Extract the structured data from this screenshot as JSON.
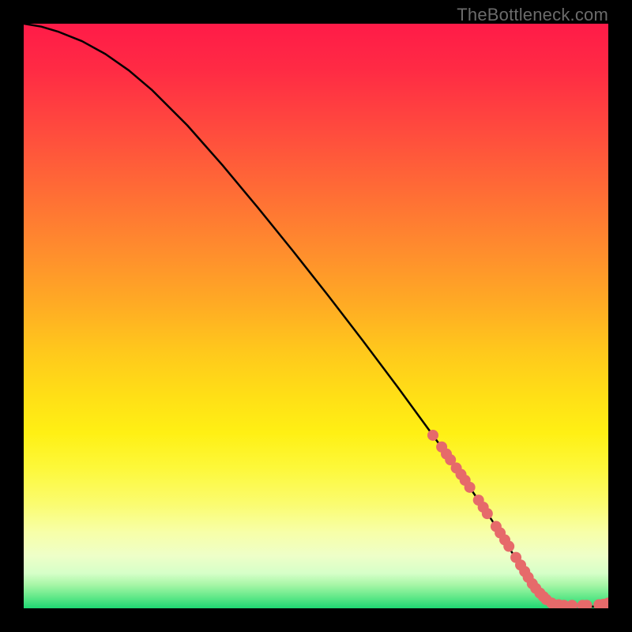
{
  "watermark": "TheBottleneck.com",
  "colors": {
    "line": "#000000",
    "dot_fill": "#e66a6a",
    "dot_stroke": "#c94f4f"
  },
  "chart_data": {
    "type": "line",
    "title": "",
    "xlabel": "",
    "ylabel": "",
    "xlim": [
      0,
      100
    ],
    "ylim": [
      0,
      100
    ],
    "series": [
      {
        "name": "curve",
        "x": [
          0,
          3,
          6,
          10,
          14,
          18,
          22,
          28,
          34,
          40,
          46,
          52,
          58,
          64,
          70,
          75,
          80,
          84,
          87,
          89,
          91,
          93,
          95,
          97,
          100
        ],
        "y": [
          100,
          99.5,
          98.6,
          97.0,
          94.8,
          92.0,
          88.6,
          82.6,
          75.8,
          68.6,
          61.2,
          53.6,
          45.8,
          37.8,
          29.6,
          22.6,
          15.2,
          8.8,
          4.0,
          2.0,
          1.0,
          0.6,
          0.4,
          0.3,
          0.3
        ]
      },
      {
        "name": "dots",
        "x": [
          70,
          71.5,
          72.3,
          73.0,
          74.0,
          74.8,
          75.5,
          76.3,
          77.8,
          78.6,
          79.3,
          80.8,
          81.5,
          82.3,
          83.0,
          84.2,
          85.0,
          85.7,
          86.3,
          87.0,
          87.6,
          88.3,
          88.9,
          89.4,
          90.3,
          91.5,
          92.4,
          93.8,
          95.6,
          96.3,
          98.4,
          99.2,
          100.0
        ],
        "y": [
          29.6,
          27.6,
          26.4,
          25.4,
          24.0,
          22.9,
          21.9,
          20.7,
          18.5,
          17.3,
          16.2,
          14.0,
          12.9,
          11.7,
          10.6,
          8.7,
          7.4,
          6.3,
          5.3,
          4.2,
          3.4,
          2.6,
          2.0,
          1.5,
          0.9,
          0.6,
          0.5,
          0.5,
          0.5,
          0.5,
          0.6,
          0.7,
          0.9
        ]
      }
    ]
  }
}
